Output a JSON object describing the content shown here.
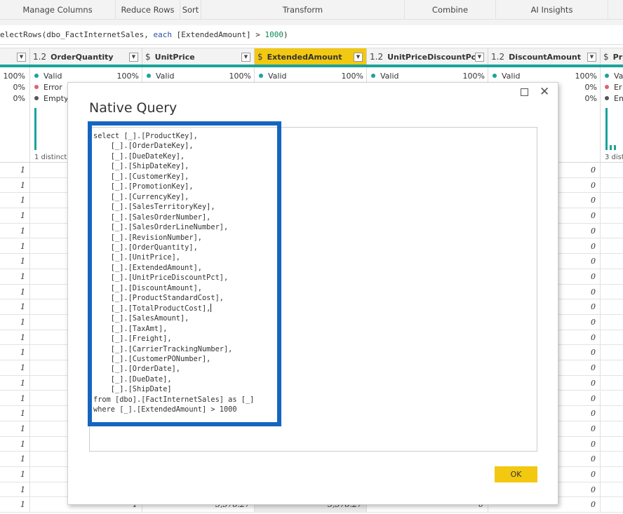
{
  "ribbon": {
    "groups": [
      "Manage Columns",
      "Reduce Rows",
      "Sort",
      "Transform",
      "Combine",
      "AI Insights"
    ]
  },
  "formula": {
    "prefix": "electRows(dbo_FactInternetSales, ",
    "keyword": "each",
    "middle": " [ExtendedAmount] > ",
    "number": "1000",
    "suffix": ")"
  },
  "columns": [
    {
      "type": "",
      "name": "",
      "selected": false
    },
    {
      "type": "1.2",
      "name": "OrderQuantity",
      "selected": false
    },
    {
      "type": "$",
      "name": "UnitPrice",
      "selected": false
    },
    {
      "type": "$",
      "name": "ExtendedAmount",
      "selected": true,
      "filtered": true
    },
    {
      "type": "1.2",
      "name": "UnitPriceDiscountPct",
      "selected": false
    },
    {
      "type": "1.2",
      "name": "DiscountAmount",
      "selected": false
    },
    {
      "type": "$",
      "name": "Pr",
      "selected": false
    }
  ],
  "quality": {
    "valid_label": "Valid",
    "error_label": "Error",
    "empty_label": "Empty",
    "col0": {
      "valid": "100%",
      "error": "0%",
      "empty": "0%"
    },
    "col1": {
      "valid_pct": "100%",
      "distinct": "1 distinct,"
    },
    "col2": {
      "valid_pct": "100%"
    },
    "col3": {
      "valid_pct": "100%"
    },
    "col4": {
      "valid_pct": "100%"
    },
    "col5": {
      "valid": "100%",
      "error": "0%",
      "empty": "0%"
    },
    "col6": {
      "valid": "Va",
      "error": "Er",
      "empty": "En",
      "distinct": "3 dist"
    },
    "colors": {
      "valid": "#1aa39a",
      "error": "#e06070",
      "empty": "#555555"
    }
  },
  "rows": {
    "left_values": [
      "1",
      "1",
      "1",
      "1",
      "1",
      "1",
      "1",
      "1",
      "1",
      "1",
      "1",
      "1",
      "1",
      "1",
      "1",
      "1",
      "1",
      "1",
      "1",
      "1",
      "1",
      "1",
      "1"
    ],
    "right_values": [
      "0",
      "0",
      "0",
      "0",
      "0",
      "0",
      "0",
      "0",
      "0",
      "0",
      "0",
      "0",
      "0",
      "0",
      "0",
      "0",
      "0",
      "0",
      "0",
      "0",
      "0",
      "0",
      "0"
    ],
    "last_row": {
      "order_qty": "1",
      "unit_price": "3,578.27",
      "extended_amount": "3,578.27",
      "discount_pct": "0",
      "discount_amount": "0"
    }
  },
  "dialog": {
    "title": "Native Query",
    "query_lines": [
      "select [_].[ProductKey],",
      "    [_].[OrderDateKey],",
      "    [_].[DueDateKey],",
      "    [_].[ShipDateKey],",
      "    [_].[CustomerKey],",
      "    [_].[PromotionKey],",
      "    [_].[CurrencyKey],",
      "    [_].[SalesTerritoryKey],",
      "    [_].[SalesOrderNumber],",
      "    [_].[SalesOrderLineNumber],",
      "    [_].[RevisionNumber],",
      "    [_].[OrderQuantity],",
      "    [_].[UnitPrice],",
      "    [_].[ExtendedAmount],",
      "    [_].[UnitPriceDiscountPct],",
      "    [_].[DiscountAmount],",
      "    [_].[ProductStandardCost],",
      "    [_].[TotalProductCost],",
      "    [_].[SalesAmount],",
      "    [_].[TaxAmt],",
      "    [_].[Freight],",
      "    [_].[CarrierTrackingNumber],",
      "    [_].[CustomerPONumber],",
      "    [_].[OrderDate],",
      "    [_].[DueDate],",
      "    [_].[ShipDate]",
      "from [dbo].[FactInternetSales] as [_]",
      "where [_].[ExtendedAmount] > 1000"
    ],
    "caret_line": 17,
    "ok_label": "OK",
    "highlight_color": "#1565c0"
  }
}
